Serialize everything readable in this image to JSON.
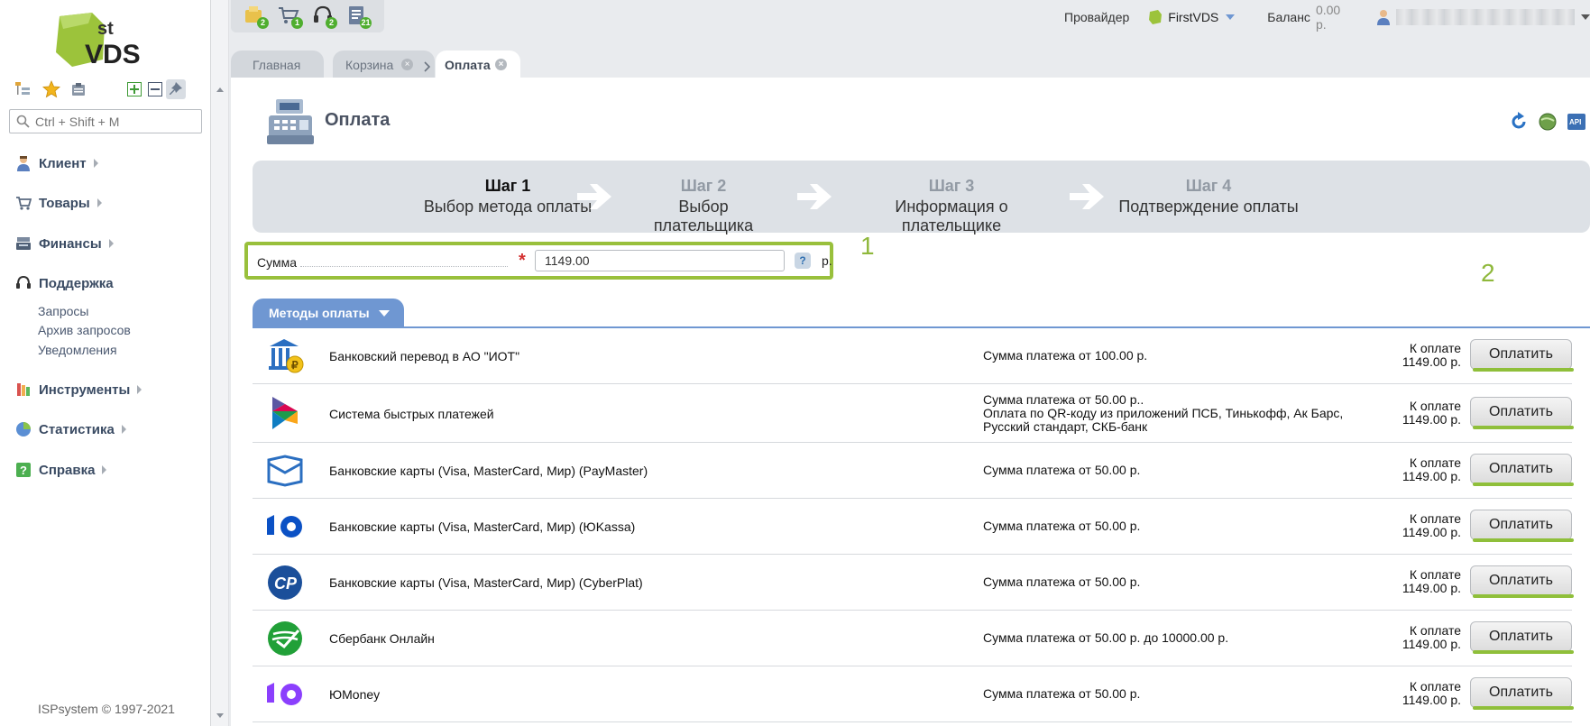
{
  "sidebar": {
    "search_placeholder": "Ctrl + Shift + M",
    "menu": [
      {
        "label": "Клиент",
        "icon": "client-icon"
      },
      {
        "label": "Товары",
        "icon": "cart-icon"
      },
      {
        "label": "Финансы",
        "icon": "finance-icon"
      },
      {
        "label": "Поддержка",
        "icon": "headset-icon",
        "sub": [
          "Запросы",
          "Архив запросов",
          "Уведомления"
        ]
      },
      {
        "label": "Инструменты",
        "icon": "tools-icon"
      },
      {
        "label": "Статистика",
        "icon": "stats-icon"
      },
      {
        "label": "Справка",
        "icon": "help-icon"
      }
    ],
    "copyright": "ISPsystem © 1997-2021"
  },
  "logo": {
    "sup": "st",
    "text": "VDS"
  },
  "topbar": {
    "badges": [
      "2",
      "1",
      "2",
      "21"
    ],
    "provider_label": "Провайдер",
    "provider_name": "FirstVDS",
    "balance_label": "Баланс",
    "balance_value": "0.00 р."
  },
  "tabs": [
    "Главная",
    "Корзина",
    "Оплата"
  ],
  "page": {
    "title": "Оплата"
  },
  "steps": [
    {
      "num": "Шаг 1",
      "label": "Выбор метода оплаты"
    },
    {
      "num": "Шаг 2",
      "label": "Выбор плательщика"
    },
    {
      "num": "Шаг 3",
      "label": "Информация о плательщике"
    },
    {
      "num": "Шаг 4",
      "label": "Подтверждение оплаты"
    }
  ],
  "sum": {
    "label": "Сумма",
    "value": "1149.00",
    "help": "?",
    "currency": "р."
  },
  "annotations": {
    "one": "1",
    "two": "2"
  },
  "methods_tab": "Методы оплаты",
  "methods": [
    {
      "name": "Банковский перевод в АО \"ИОТ\"",
      "desc": "Сумма платежа от 100.00 р.",
      "pay_label": "К оплате",
      "pay_value": "1149.00 р.",
      "button": "Оплатить",
      "icon": "bank-transfer-icon"
    },
    {
      "name": "Система быстрых платежей",
      "desc": "Сумма платежа от 50.00 р.. Оплата по QR-коду из приложений ПСБ, Тинькофф, Ак Барс, Русский стандарт, СКБ-банк",
      "pay_label": "К оплате",
      "pay_value": "1149.00 р.",
      "button": "Оплатить",
      "icon": "sbp-icon"
    },
    {
      "name": "Банковские карты (Visa, MasterCard, Мир) (PayMaster)",
      "desc": "Сумма платежа от 50.00 р.",
      "pay_label": "К оплате",
      "pay_value": "1149.00 р.",
      "button": "Оплатить",
      "icon": "paymaster-icon"
    },
    {
      "name": "Банковские карты (Visa, MasterCard, Мир) (ЮKassa)",
      "desc": "Сумма платежа от 50.00 р.",
      "pay_label": "К оплате",
      "pay_value": "1149.00 р.",
      "button": "Оплатить",
      "icon": "yookassa-icon"
    },
    {
      "name": "Банковские карты (Visa, MasterCard, Мир) (CyberPlat)",
      "desc": "Сумма платежа от 50.00 р.",
      "pay_label": "К оплате",
      "pay_value": "1149.00 р.",
      "button": "Оплатить",
      "icon": "cyberplat-icon"
    },
    {
      "name": "Сбербанк Онлайн",
      "desc": "Сумма платежа от 50.00 р. до 10000.00 р.",
      "pay_label": "К оплате",
      "pay_value": "1149.00 р.",
      "button": "Оплатить",
      "icon": "sberbank-icon"
    },
    {
      "name": "ЮMoney",
      "desc": "Сумма платежа от 50.00 р.",
      "pay_label": "К оплате",
      "pay_value": "1149.00 р.",
      "button": "Оплатить",
      "icon": "yoomoney-icon"
    }
  ],
  "colors": {
    "accent_green": "#99c03c",
    "tab_blue": "#6f97d2"
  }
}
